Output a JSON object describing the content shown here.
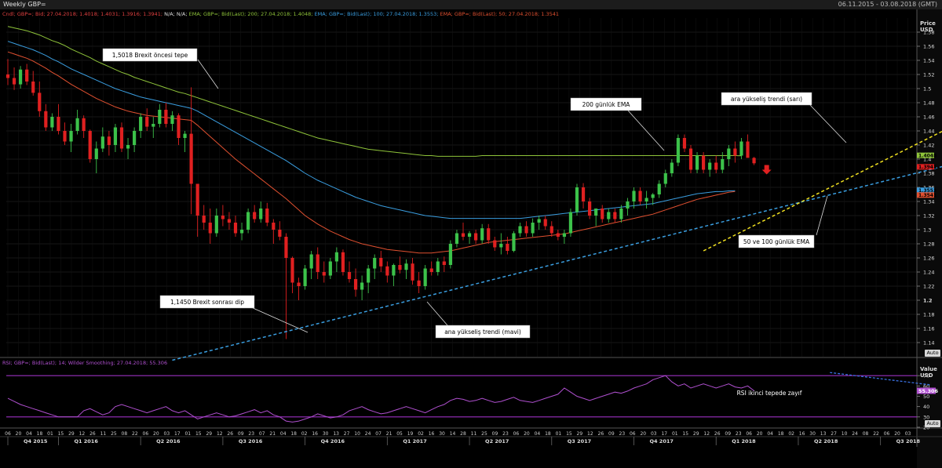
{
  "header": {
    "title": "Weekly GBP=",
    "date_range": "06.11.2015 - 03.08.2018 (GMT)"
  },
  "legend_price": [
    {
      "text": "Cndl; GBP=; Bid; 27.04.2018; 1.4018; 1.4031; 1.3916; 1.3941;",
      "color": "#e04040"
    },
    {
      "text": " N/A; N/A;",
      "color": "#dddddd"
    },
    {
      "text": " EMA; GBP=; Bid(Last); 200; 27.04.2018; 1.4048;",
      "color": "#8fc43a"
    },
    {
      "text": " EMA; GBP=; Bid(Last); 100; 27.04.2018; 1.3553;",
      "color": "#3a9ee0"
    },
    {
      "text": " EMA; GBP=; Bid(Last); 50; 27.04.2018; 1.3541",
      "color": "#e05030"
    }
  ],
  "legend_rsi": {
    "text": "RSI; GBP=; Bid(Last); 14; Wilder Smoothing; 27.04.2018; 55.306",
    "color": "#b050d0"
  },
  "price_axis": {
    "title_line1": "Price",
    "title_line2": "USD",
    "auto_label": "Auto"
  },
  "rsi_axis": {
    "title_line1": "Value",
    "title_line2": "USD",
    "auto_label": "Auto"
  },
  "colors": {
    "up": "#3cc24a",
    "down": "#e02020",
    "ema200": "#8fc43a",
    "ema100": "#3a9ee0",
    "ema50": "#e05030",
    "rsi": "#b050d0",
    "trend_blue": "#3a9ee0",
    "trend_yellow": "#f0e020",
    "grid": "#2c2c2c"
  },
  "annotations": [
    {
      "id": "pre-brexit-top",
      "text": "1,5018 Brexit öncesi tepe"
    },
    {
      "id": "post-brexit-dip",
      "text": "1,1450 Brexit sonrası dip"
    },
    {
      "id": "ema200-label",
      "text": "200 günlük EMA"
    },
    {
      "id": "yellow-trend-label",
      "text": "ara yükseliş trendi (sarı)"
    },
    {
      "id": "blue-trend-label",
      "text": "ana yükseliş trendi (mavi)"
    },
    {
      "id": "ema-50-100-label",
      "text": "50 ve 100 günlük EMA"
    },
    {
      "id": "rsi-label",
      "text": "RSI ikinci tepede zayıf"
    }
  ],
  "chart_data": {
    "type": "candlestick",
    "price_ylim": [
      1.12,
      1.6
    ],
    "price_ticks": [
      "1.58",
      "1.56",
      "1.54",
      "1.52",
      "1.5",
      "1.48",
      "1.46",
      "1.44",
      "1.42",
      "1.4",
      "1.38",
      "1.36",
      "1.34",
      "1.32",
      "1.3",
      "1.28",
      "1.26",
      "1.24",
      "1.22",
      "1.2",
      "1.18",
      "1.16",
      "1.14"
    ],
    "rsi_ylim": [
      20,
      80
    ],
    "rsi_ticks": [
      "70",
      "60",
      "50",
      "40",
      "30",
      "20"
    ],
    "rsi_levels": [
      70,
      30
    ],
    "value_tags": [
      {
        "text": "1.4048",
        "value": 1.4048,
        "color": "#8fc43a"
      },
      {
        "text": "1.3941",
        "value": 1.3941,
        "color": "#e02020"
      },
      {
        "text": "1.3553",
        "value": 1.3553,
        "color": "#3a9ee0"
      },
      {
        "text": "1.3541",
        "value": 1.3541,
        "color": "#e05030"
      }
    ],
    "rsi_tag": {
      "text": "55.306",
      "value": 55.306
    },
    "x_tick_labels": [
      "06",
      "20",
      "04",
      "18",
      "01",
      "15",
      "29",
      "12",
      "26",
      "11",
      "25",
      "08",
      "22",
      "06",
      "20",
      "03",
      "17",
      "01",
      "15",
      "29",
      "12",
      "26",
      "09",
      "23",
      "07",
      "21",
      "04",
      "18",
      "02",
      "16",
      "30",
      "13",
      "27",
      "10",
      "24",
      "07",
      "21",
      "05",
      "19",
      "02",
      "16",
      "30",
      "14",
      "28",
      "11",
      "25",
      "09",
      "23",
      "06",
      "20",
      "04",
      "18",
      "01",
      "15",
      "29",
      "12",
      "26",
      "09",
      "23",
      "06",
      "20",
      "03",
      "17",
      "01",
      "15",
      "29",
      "12",
      "26",
      "09",
      "23",
      "06",
      "20",
      "04",
      "18",
      "02",
      "16",
      "30",
      "13",
      "27",
      "10",
      "24",
      "08",
      "22",
      "06",
      "20",
      "03"
    ],
    "quarters": [
      {
        "label": "Q4 2015",
        "week": 0
      },
      {
        "label": "Q1 2016",
        "week": 8
      },
      {
        "label": "Q2 2016",
        "week": 21
      },
      {
        "label": "Q3 2016",
        "week": 34
      },
      {
        "label": "Q4 2016",
        "week": 47
      },
      {
        "label": "Q1 2017",
        "week": 60
      },
      {
        "label": "Q2 2017",
        "week": 73
      },
      {
        "label": "Q3 2017",
        "week": 86
      },
      {
        "label": "Q4 2017",
        "week": 99
      },
      {
        "label": "Q1 2018",
        "week": 112
      },
      {
        "label": "Q2 2018",
        "week": 125
      },
      {
        "label": "Q3 2018",
        "week": 138
      }
    ],
    "weeks_total": 144,
    "ohlc": [
      [
        1.52,
        1.542,
        1.505,
        1.515
      ],
      [
        1.515,
        1.53,
        1.498,
        1.506
      ],
      [
        1.506,
        1.532,
        1.5,
        1.527
      ],
      [
        1.527,
        1.535,
        1.505,
        1.51
      ],
      [
        1.51,
        1.525,
        1.49,
        1.494
      ],
      [
        1.494,
        1.51,
        1.46,
        1.468
      ],
      [
        1.468,
        1.478,
        1.44,
        1.445
      ],
      [
        1.445,
        1.465,
        1.44,
        1.46
      ],
      [
        1.46,
        1.478,
        1.435,
        1.44
      ],
      [
        1.44,
        1.452,
        1.42,
        1.425
      ],
      [
        1.425,
        1.45,
        1.41,
        1.44
      ],
      [
        1.44,
        1.47,
        1.435,
        1.458
      ],
      [
        1.458,
        1.462,
        1.43,
        1.44
      ],
      [
        1.44,
        1.442,
        1.395,
        1.4
      ],
      [
        1.4,
        1.425,
        1.38,
        1.415
      ],
      [
        1.415,
        1.445,
        1.41,
        1.432
      ],
      [
        1.432,
        1.44,
        1.405,
        1.42
      ],
      [
        1.42,
        1.45,
        1.41,
        1.445
      ],
      [
        1.445,
        1.452,
        1.41,
        1.415
      ],
      [
        1.415,
        1.43,
        1.4,
        1.42
      ],
      [
        1.42,
        1.445,
        1.41,
        1.44
      ],
      [
        1.44,
        1.465,
        1.43,
        1.46
      ],
      [
        1.46,
        1.472,
        1.44,
        1.446
      ],
      [
        1.446,
        1.46,
        1.43,
        1.45
      ],
      [
        1.45,
        1.478,
        1.445,
        1.47
      ],
      [
        1.47,
        1.48,
        1.445,
        1.45
      ],
      [
        1.45,
        1.468,
        1.44,
        1.462
      ],
      [
        1.462,
        1.465,
        1.42,
        1.43
      ],
      [
        1.43,
        1.44,
        1.41,
        1.436
      ],
      [
        1.436,
        1.5018,
        1.322,
        1.365
      ],
      [
        1.365,
        1.36,
        1.29,
        1.32
      ],
      [
        1.32,
        1.335,
        1.3,
        1.31
      ],
      [
        1.31,
        1.33,
        1.28,
        1.295
      ],
      [
        1.295,
        1.33,
        1.29,
        1.32
      ],
      [
        1.32,
        1.335,
        1.305,
        1.315
      ],
      [
        1.315,
        1.325,
        1.3,
        1.31
      ],
      [
        1.31,
        1.32,
        1.29,
        1.295
      ],
      [
        1.295,
        1.31,
        1.285,
        1.3
      ],
      [
        1.3,
        1.33,
        1.295,
        1.325
      ],
      [
        1.325,
        1.335,
        1.31,
        1.315
      ],
      [
        1.315,
        1.34,
        1.31,
        1.33
      ],
      [
        1.33,
        1.338,
        1.305,
        1.31
      ],
      [
        1.31,
        1.315,
        1.28,
        1.3
      ],
      [
        1.3,
        1.312,
        1.285,
        1.29
      ],
      [
        1.29,
        1.295,
        1.145,
        1.26
      ],
      [
        1.26,
        1.262,
        1.21,
        1.225
      ],
      [
        1.225,
        1.232,
        1.2,
        1.22
      ],
      [
        1.22,
        1.25,
        1.215,
        1.245
      ],
      [
        1.245,
        1.27,
        1.23,
        1.265
      ],
      [
        1.265,
        1.275,
        1.23,
        1.24
      ],
      [
        1.24,
        1.255,
        1.225,
        1.235
      ],
      [
        1.235,
        1.26,
        1.23,
        1.255
      ],
      [
        1.255,
        1.275,
        1.24,
        1.268
      ],
      [
        1.268,
        1.272,
        1.235,
        1.24
      ],
      [
        1.24,
        1.255,
        1.225,
        1.23
      ],
      [
        1.23,
        1.245,
        1.205,
        1.215
      ],
      [
        1.215,
        1.235,
        1.2,
        1.225
      ],
      [
        1.225,
        1.25,
        1.21,
        1.245
      ],
      [
        1.245,
        1.265,
        1.23,
        1.26
      ],
      [
        1.26,
        1.27,
        1.24,
        1.248
      ],
      [
        1.248,
        1.255,
        1.225,
        1.235
      ],
      [
        1.235,
        1.252,
        1.22,
        1.25
      ],
      [
        1.25,
        1.262,
        1.238,
        1.243
      ],
      [
        1.243,
        1.258,
        1.23,
        1.252
      ],
      [
        1.252,
        1.26,
        1.222,
        1.228
      ],
      [
        1.228,
        1.24,
        1.21,
        1.22
      ],
      [
        1.22,
        1.25,
        1.215,
        1.245
      ],
      [
        1.245,
        1.255,
        1.235,
        1.24
      ],
      [
        1.24,
        1.26,
        1.235,
        1.255
      ],
      [
        1.255,
        1.262,
        1.24,
        1.25
      ],
      [
        1.25,
        1.285,
        1.245,
        1.28
      ],
      [
        1.28,
        1.3,
        1.275,
        1.295
      ],
      [
        1.295,
        1.31,
        1.285,
        1.29
      ],
      [
        1.29,
        1.298,
        1.28,
        1.295
      ],
      [
        1.295,
        1.3,
        1.28,
        1.285
      ],
      [
        1.285,
        1.308,
        1.28,
        1.302
      ],
      [
        1.302,
        1.308,
        1.28,
        1.285
      ],
      [
        1.285,
        1.29,
        1.27,
        1.275
      ],
      [
        1.275,
        1.295,
        1.265,
        1.28
      ],
      [
        1.28,
        1.29,
        1.265,
        1.27
      ],
      [
        1.27,
        1.298,
        1.268,
        1.295
      ],
      [
        1.295,
        1.31,
        1.29,
        1.305
      ],
      [
        1.305,
        1.312,
        1.29,
        1.295
      ],
      [
        1.295,
        1.316,
        1.29,
        1.31
      ],
      [
        1.31,
        1.32,
        1.3,
        1.315
      ],
      [
        1.315,
        1.32,
        1.3,
        1.305
      ],
      [
        1.305,
        1.312,
        1.29,
        1.295
      ],
      [
        1.295,
        1.3,
        1.285,
        1.29
      ],
      [
        1.29,
        1.3,
        1.28,
        1.295
      ],
      [
        1.295,
        1.33,
        1.29,
        1.325
      ],
      [
        1.325,
        1.365,
        1.32,
        1.36
      ],
      [
        1.36,
        1.366,
        1.33,
        1.34
      ],
      [
        1.34,
        1.345,
        1.315,
        1.32
      ],
      [
        1.32,
        1.33,
        1.305,
        1.33
      ],
      [
        1.33,
        1.335,
        1.31,
        1.315
      ],
      [
        1.315,
        1.33,
        1.31,
        1.325
      ],
      [
        1.325,
        1.33,
        1.31,
        1.315
      ],
      [
        1.315,
        1.335,
        1.31,
        1.33
      ],
      [
        1.33,
        1.345,
        1.32,
        1.34
      ],
      [
        1.34,
        1.36,
        1.33,
        1.355
      ],
      [
        1.355,
        1.36,
        1.335,
        1.34
      ],
      [
        1.34,
        1.355,
        1.33,
        1.345
      ],
      [
        1.345,
        1.352,
        1.335,
        1.35
      ],
      [
        1.35,
        1.37,
        1.345,
        1.365
      ],
      [
        1.365,
        1.385,
        1.36,
        1.38
      ],
      [
        1.38,
        1.4,
        1.375,
        1.395
      ],
      [
        1.395,
        1.435,
        1.39,
        1.43
      ],
      [
        1.43,
        1.435,
        1.41,
        1.415
      ],
      [
        1.415,
        1.42,
        1.38,
        1.385
      ],
      [
        1.385,
        1.41,
        1.38,
        1.405
      ],
      [
        1.405,
        1.41,
        1.38,
        1.385
      ],
      [
        1.385,
        1.4,
        1.375,
        1.395
      ],
      [
        1.395,
        1.405,
        1.38,
        1.385
      ],
      [
        1.385,
        1.41,
        1.38,
        1.4
      ],
      [
        1.4,
        1.42,
        1.39,
        1.415
      ],
      [
        1.415,
        1.425,
        1.395,
        1.405
      ],
      [
        1.405,
        1.43,
        1.4,
        1.425
      ],
      [
        1.425,
        1.435,
        1.41,
        1.4018
      ],
      [
        1.4018,
        1.4031,
        1.3916,
        1.3941
      ]
    ],
    "ema200": [
      1.588,
      1.586,
      1.584,
      1.582,
      1.579,
      1.576,
      1.572,
      1.568,
      1.565,
      1.561,
      1.556,
      1.552,
      1.548,
      1.544,
      1.539,
      1.535,
      1.531,
      1.527,
      1.523,
      1.52,
      1.516,
      1.513,
      1.51,
      1.507,
      1.504,
      1.501,
      1.498,
      1.495,
      1.493,
      1.49,
      1.487,
      1.484,
      1.481,
      1.478,
      1.475,
      1.472,
      1.469,
      1.466,
      1.463,
      1.46,
      1.457,
      1.454,
      1.451,
      1.448,
      1.445,
      1.442,
      1.439,
      1.436,
      1.433,
      1.43,
      1.428,
      1.426,
      1.424,
      1.422,
      1.42,
      1.418,
      1.416,
      1.414,
      1.413,
      1.412,
      1.411,
      1.41,
      1.409,
      1.408,
      1.407,
      1.406,
      1.405,
      1.405,
      1.404,
      1.404,
      1.404,
      1.404,
      1.404,
      1.404,
      1.404,
      1.405,
      1.405,
      1.405,
      1.405,
      1.405,
      1.405,
      1.405,
      1.405,
      1.405,
      1.405,
      1.405,
      1.405,
      1.405,
      1.405,
      1.405,
      1.405,
      1.405,
      1.405,
      1.405,
      1.405,
      1.405,
      1.405,
      1.405,
      1.405,
      1.405,
      1.405,
      1.405,
      1.405,
      1.405,
      1.405,
      1.405,
      1.405,
      1.405,
      1.405,
      1.405,
      1.405,
      1.405,
      1.405,
      1.405,
      1.405,
      1.405,
      1.4048
    ],
    "ema100": [
      1.567,
      1.564,
      1.561,
      1.558,
      1.555,
      1.551,
      1.547,
      1.542,
      1.538,
      1.533,
      1.528,
      1.524,
      1.52,
      1.516,
      1.512,
      1.508,
      1.504,
      1.5,
      1.497,
      1.494,
      1.491,
      1.488,
      1.486,
      1.484,
      1.482,
      1.48,
      1.478,
      1.476,
      1.474,
      1.472,
      1.468,
      1.463,
      1.458,
      1.453,
      1.448,
      1.443,
      1.438,
      1.433,
      1.428,
      1.423,
      1.418,
      1.413,
      1.408,
      1.403,
      1.398,
      1.392,
      1.386,
      1.38,
      1.375,
      1.37,
      1.366,
      1.362,
      1.358,
      1.354,
      1.35,
      1.346,
      1.343,
      1.34,
      1.337,
      1.334,
      1.332,
      1.33,
      1.328,
      1.326,
      1.324,
      1.322,
      1.32,
      1.319,
      1.318,
      1.317,
      1.316,
      1.316,
      1.316,
      1.316,
      1.316,
      1.316,
      1.316,
      1.316,
      1.316,
      1.316,
      1.316,
      1.316,
      1.317,
      1.318,
      1.319,
      1.32,
      1.321,
      1.322,
      1.323,
      1.324,
      1.325,
      1.326,
      1.327,
      1.328,
      1.329,
      1.33,
      1.331,
      1.332,
      1.333,
      1.334,
      1.335,
      1.336,
      1.337,
      1.339,
      1.341,
      1.343,
      1.345,
      1.347,
      1.349,
      1.351,
      1.352,
      1.353,
      1.354,
      1.354,
      1.355,
      1.3553
    ],
    "ema50": [
      1.552,
      1.549,
      1.546,
      1.543,
      1.539,
      1.534,
      1.529,
      1.523,
      1.518,
      1.512,
      1.506,
      1.501,
      1.496,
      1.491,
      1.486,
      1.482,
      1.478,
      1.474,
      1.471,
      1.468,
      1.466,
      1.464,
      1.462,
      1.461,
      1.46,
      1.459,
      1.458,
      1.457,
      1.456,
      1.455,
      1.448,
      1.44,
      1.432,
      1.424,
      1.416,
      1.408,
      1.4,
      1.393,
      1.386,
      1.379,
      1.372,
      1.365,
      1.358,
      1.351,
      1.344,
      1.336,
      1.328,
      1.32,
      1.314,
      1.308,
      1.303,
      1.298,
      1.294,
      1.29,
      1.286,
      1.283,
      1.28,
      1.278,
      1.276,
      1.274,
      1.272,
      1.271,
      1.27,
      1.269,
      1.268,
      1.267,
      1.267,
      1.267,
      1.268,
      1.269,
      1.27,
      1.272,
      1.274,
      1.276,
      1.278,
      1.28,
      1.282,
      1.283,
      1.284,
      1.285,
      1.286,
      1.287,
      1.288,
      1.289,
      1.29,
      1.291,
      1.292,
      1.293,
      1.294,
      1.296,
      1.298,
      1.3,
      1.302,
      1.304,
      1.306,
      1.308,
      1.31,
      1.312,
      1.314,
      1.316,
      1.318,
      1.32,
      1.322,
      1.325,
      1.328,
      1.331,
      1.334,
      1.337,
      1.34,
      1.343,
      1.345,
      1.347,
      1.349,
      1.351,
      1.353,
      1.3541
    ],
    "rsi": [
      48,
      45,
      42,
      40,
      38,
      36,
      34,
      32,
      30,
      30,
      30,
      30,
      36,
      38,
      35,
      32,
      34,
      40,
      42,
      40,
      38,
      36,
      34,
      36,
      38,
      40,
      36,
      34,
      36,
      32,
      28,
      30,
      32,
      34,
      32,
      30,
      31,
      33,
      35,
      37,
      34,
      36,
      32,
      30,
      26,
      25,
      26,
      28,
      30,
      33,
      31,
      29,
      30,
      32,
      36,
      38,
      40,
      37,
      35,
      33,
      34,
      36,
      38,
      40,
      38,
      36,
      34,
      37,
      40,
      42,
      46,
      48,
      47,
      45,
      46,
      48,
      46,
      44,
      45,
      47,
      49,
      46,
      45,
      44,
      46,
      48,
      50,
      52,
      58,
      54,
      50,
      48,
      46,
      48,
      50,
      52,
      54,
      53,
      55,
      58,
      60,
      62,
      66,
      68,
      70,
      64,
      60,
      62,
      58,
      60,
      62,
      60,
      58,
      60,
      62,
      59,
      58,
      60,
      55.306
    ],
    "trend_blue": {
      "start": [
        26,
        1.115
      ],
      "end": [
        148,
        1.39
      ]
    },
    "trend_yellow": {
      "start": [
        110,
        1.27
      ],
      "end": [
        149,
        1.445
      ]
    },
    "rsi_trend": {
      "start": [
        130,
        73
      ],
      "end": [
        146,
        61
      ]
    }
  }
}
